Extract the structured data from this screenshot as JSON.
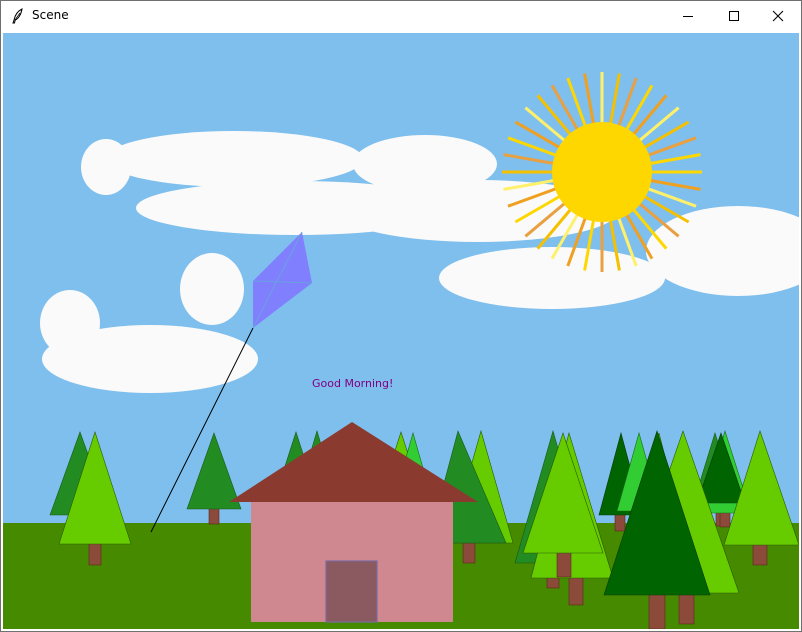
{
  "window": {
    "title": "Scene",
    "controls": [
      "minimize-icon",
      "maximize-icon",
      "close-icon"
    ]
  },
  "scene": {
    "greeting": "Good Morning!",
    "colors": {
      "sky": "#7fbfed",
      "grass": "#468a00",
      "cloud": "#fafafa",
      "sun": "#ffd700",
      "ray_colors": [
        "#ffd700",
        "#f0a020",
        "#fff06a",
        "#f5c000",
        "#e8a040"
      ],
      "kite": "#8080ff",
      "kite_string": "#000000",
      "house_wall": "#d08890",
      "house_roof": "#8b3a30",
      "house_door": "#8b5a60",
      "trunk": "#8b4a3a",
      "greeting_text": "#800080",
      "tree_greens": [
        "#228b22",
        "#66cc00",
        "#006400",
        "#32cd32"
      ]
    }
  }
}
